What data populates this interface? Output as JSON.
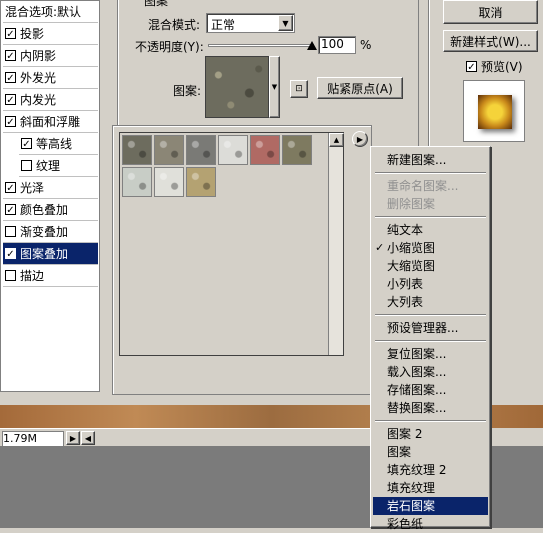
{
  "styles_list": {
    "items": [
      {
        "label": "混合选项:默认",
        "checkbox": false,
        "head": true
      },
      {
        "label": "投影",
        "checkbox": true,
        "checked": true
      },
      {
        "label": "内阴影",
        "checkbox": true,
        "checked": true
      },
      {
        "label": "外发光",
        "checkbox": true,
        "checked": true
      },
      {
        "label": "内发光",
        "checkbox": true,
        "checked": true
      },
      {
        "label": "斜面和浮雕",
        "checkbox": true,
        "checked": true
      },
      {
        "label": "等高线",
        "checkbox": true,
        "checked": true,
        "sub": true
      },
      {
        "label": "纹理",
        "checkbox": true,
        "checked": false,
        "sub": true
      },
      {
        "label": "光泽",
        "checkbox": true,
        "checked": true
      },
      {
        "label": "颜色叠加",
        "checkbox": true,
        "checked": true
      },
      {
        "label": "渐变叠加",
        "checkbox": true,
        "checked": false
      },
      {
        "label": "图案叠加",
        "checkbox": true,
        "checked": true,
        "selected": true
      },
      {
        "label": "描边",
        "checkbox": true,
        "checked": false
      }
    ]
  },
  "pattern_panel": {
    "group_title": "图案",
    "blend_mode_label": "混合模式:",
    "blend_mode_value": "正常",
    "opacity_label": "不透明度(Y):",
    "opacity_value": "100",
    "opacity_unit": "%",
    "pattern_label": "图案:",
    "snap_origin_label": "贴紧原点(A)"
  },
  "right_buttons": {
    "cancel": "取消",
    "new_style": "新建样式(W)...",
    "preview_label": "预览(V)",
    "preview_checked": true
  },
  "statusbar": {
    "size": "1.79M"
  },
  "pattern_picker": {
    "swatch_colors": [
      "#6d6c5e",
      "#8b8676",
      "#7a7a76",
      "#dcdcd8",
      "#b06a64",
      "#7e7a60",
      "#c8cdc6",
      "#e0e0da",
      "#b4a272"
    ]
  },
  "context_menu": {
    "items": [
      {
        "label": "新建图案...",
        "disabled": false
      },
      {
        "sep": true
      },
      {
        "label": "重命名图案...",
        "disabled": true
      },
      {
        "label": "删除图案",
        "disabled": true
      },
      {
        "sep": true
      },
      {
        "label": "纯文本",
        "disabled": false
      },
      {
        "label": "小缩览图",
        "disabled": false,
        "checked": true
      },
      {
        "label": "大缩览图",
        "disabled": false
      },
      {
        "label": "小列表",
        "disabled": false
      },
      {
        "label": "大列表",
        "disabled": false
      },
      {
        "sep": true
      },
      {
        "label": "预设管理器...",
        "disabled": false
      },
      {
        "sep": true
      },
      {
        "label": "复位图案...",
        "disabled": false
      },
      {
        "label": "载入图案...",
        "disabled": false
      },
      {
        "label": "存储图案...",
        "disabled": false
      },
      {
        "label": "替换图案...",
        "disabled": false
      },
      {
        "sep": true
      },
      {
        "label": "图案 2",
        "disabled": false
      },
      {
        "label": "图案",
        "disabled": false
      },
      {
        "label": "填充纹理 2",
        "disabled": false
      },
      {
        "label": "填充纹理",
        "disabled": false
      },
      {
        "label": "岩石图案",
        "disabled": false,
        "selected": true
      },
      {
        "label": "彩色纸",
        "disabled": false
      }
    ]
  }
}
